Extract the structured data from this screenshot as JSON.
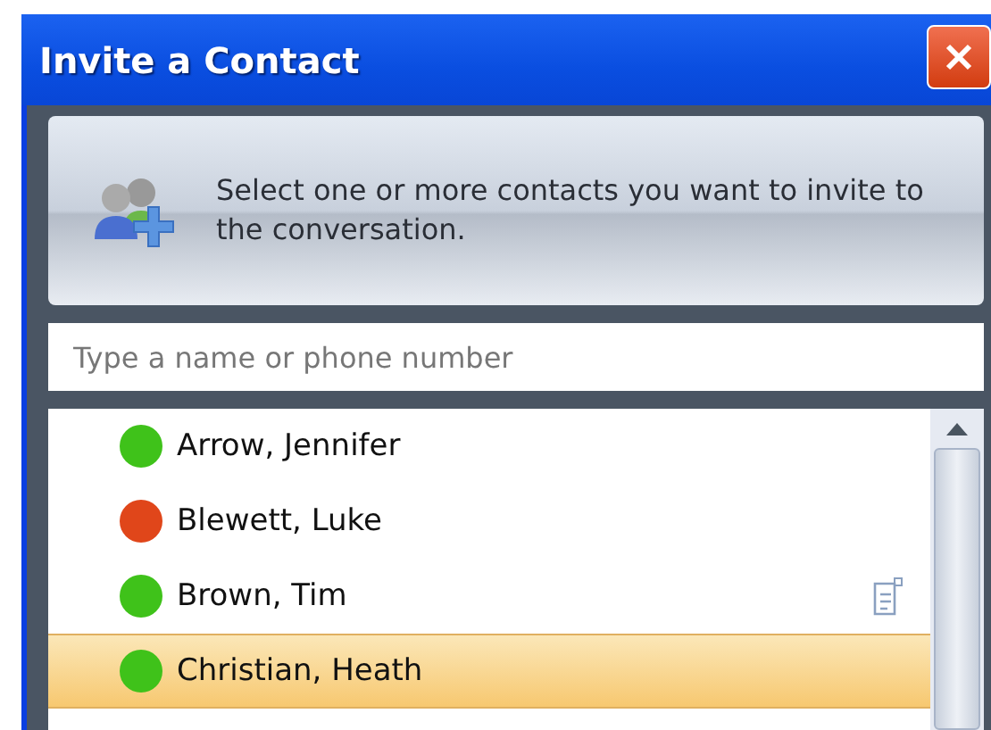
{
  "window": {
    "title": "Invite a Contact"
  },
  "header": {
    "text": "Select one or more contacts you want to invite to the conversation."
  },
  "search": {
    "placeholder": "Type a name or phone number"
  },
  "contacts": [
    {
      "name": "Arrow, Jennifer",
      "color": "#3fc21a",
      "note": false,
      "selected": false
    },
    {
      "name": "Blewett, Luke",
      "color": "#e0461a",
      "note": false,
      "selected": false
    },
    {
      "name": "Brown, Tim",
      "color": "#3fc21a",
      "note": true,
      "selected": false
    },
    {
      "name": "Christian, Heath",
      "color": "#3fc21a",
      "note": false,
      "selected": true
    }
  ]
}
